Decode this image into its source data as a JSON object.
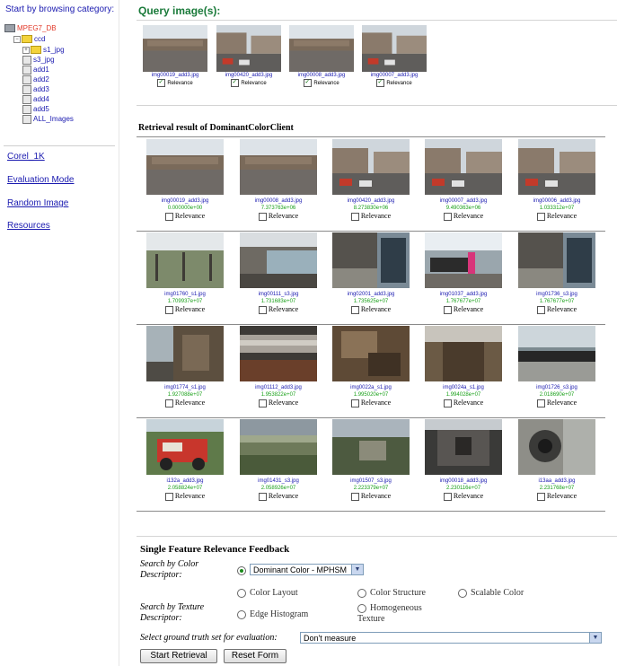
{
  "sidebar": {
    "title": "Start by browsing category:",
    "tree": [
      {
        "label": "MPEG7_DB",
        "icon": "database-icon",
        "level": 0
      },
      {
        "label": "ccd",
        "icon": "folder-icon",
        "level": 1
      },
      {
        "label": "s1_jpg",
        "icon": "folder-icon",
        "level": 2
      },
      {
        "label": "s3_jpg",
        "icon": "image-icon",
        "level": 2
      },
      {
        "label": "add1",
        "icon": "image-icon",
        "level": 2
      },
      {
        "label": "add2",
        "icon": "image-icon",
        "level": 2
      },
      {
        "label": "add3",
        "icon": "image-icon",
        "level": 2
      },
      {
        "label": "add4",
        "icon": "image-icon",
        "level": 2
      },
      {
        "label": "add5",
        "icon": "image-icon",
        "level": 2
      },
      {
        "label": "ALL_Images",
        "icon": "image-icon",
        "level": 2
      }
    ],
    "links": [
      "Corel_1K",
      "Evaluation Mode",
      "Random Image",
      "Resources"
    ]
  },
  "query": {
    "title": "Query image(s):",
    "relevance_label": "Relevance",
    "items": [
      {
        "file": "img00019_add3.jpg",
        "checked": true
      },
      {
        "file": "img00420_add3.jpg",
        "checked": true
      },
      {
        "file": "img00008_add3.jpg",
        "checked": true
      },
      {
        "file": "img00007_add3.jpg",
        "checked": true
      }
    ]
  },
  "results": {
    "title": "Retrieval result of DominantColorClient",
    "relevance_label": "Relevance",
    "rows": [
      [
        {
          "file": "img00019_add3.jpg",
          "score": "0.000000e+00"
        },
        {
          "file": "img00008_add3.jpg",
          "score": "7.373763e+06"
        },
        {
          "file": "img00420_add3.jpg",
          "score": "8.273830e+06"
        },
        {
          "file": "img00007_add3.jpg",
          "score": "9.490363e+06"
        },
        {
          "file": "img00006_add3.jpg",
          "score": "1.033312e+07"
        }
      ],
      [
        {
          "file": "img01760_s1.jpg",
          "score": "1.709937e+07"
        },
        {
          "file": "img00111_s3.jpg",
          "score": "1.731683e+07"
        },
        {
          "file": "img02001_add3.jpg",
          "score": "1.735625e+07"
        },
        {
          "file": "img01037_add3.jpg",
          "score": "1.767677e+07"
        },
        {
          "file": "img01736_s3.jpg",
          "score": "1.767677e+07"
        }
      ],
      [
        {
          "file": "img01774_s1.jpg",
          "score": "1.927088e+07"
        },
        {
          "file": "img01112_add3.jpg",
          "score": "1.953822e+07"
        },
        {
          "file": "img0022a_s1.jpg",
          "score": "1.995020e+07"
        },
        {
          "file": "img0024a_s1.jpg",
          "score": "1.994028e+07"
        },
        {
          "file": "img01726_s3.jpg",
          "score": "2.018690e+07"
        }
      ],
      [
        {
          "file": "i132a_add3.jpg",
          "score": "2.058824e+07"
        },
        {
          "file": "img01431_s3.jpg",
          "score": "2.058926e+07"
        },
        {
          "file": "img01507_s3.jpg",
          "score": "2.223379e+07"
        },
        {
          "file": "img00018_add3.jpg",
          "score": "2.230116e+07"
        },
        {
          "file": "i13aa_add3.jpg",
          "score": "2.231768e+07"
        }
      ]
    ]
  },
  "feedback": {
    "title": "Single Feature Relevance Feedback",
    "color_label": "Search by Color Descriptor:",
    "color_selected": "Dominant Color - MPHSM",
    "color_options": [
      "Color Layout",
      "Color Structure",
      "Scalable Color"
    ],
    "texture_label": "Search by Texture Descriptor:",
    "texture_options": [
      "Edge Histogram",
      "Homogeneous Texture"
    ],
    "ground_truth_label": "Select ground truth set for evaluation:",
    "ground_truth_value": "Don't measure",
    "start_button": "Start Retrieval",
    "reset_button": "Reset Form"
  }
}
